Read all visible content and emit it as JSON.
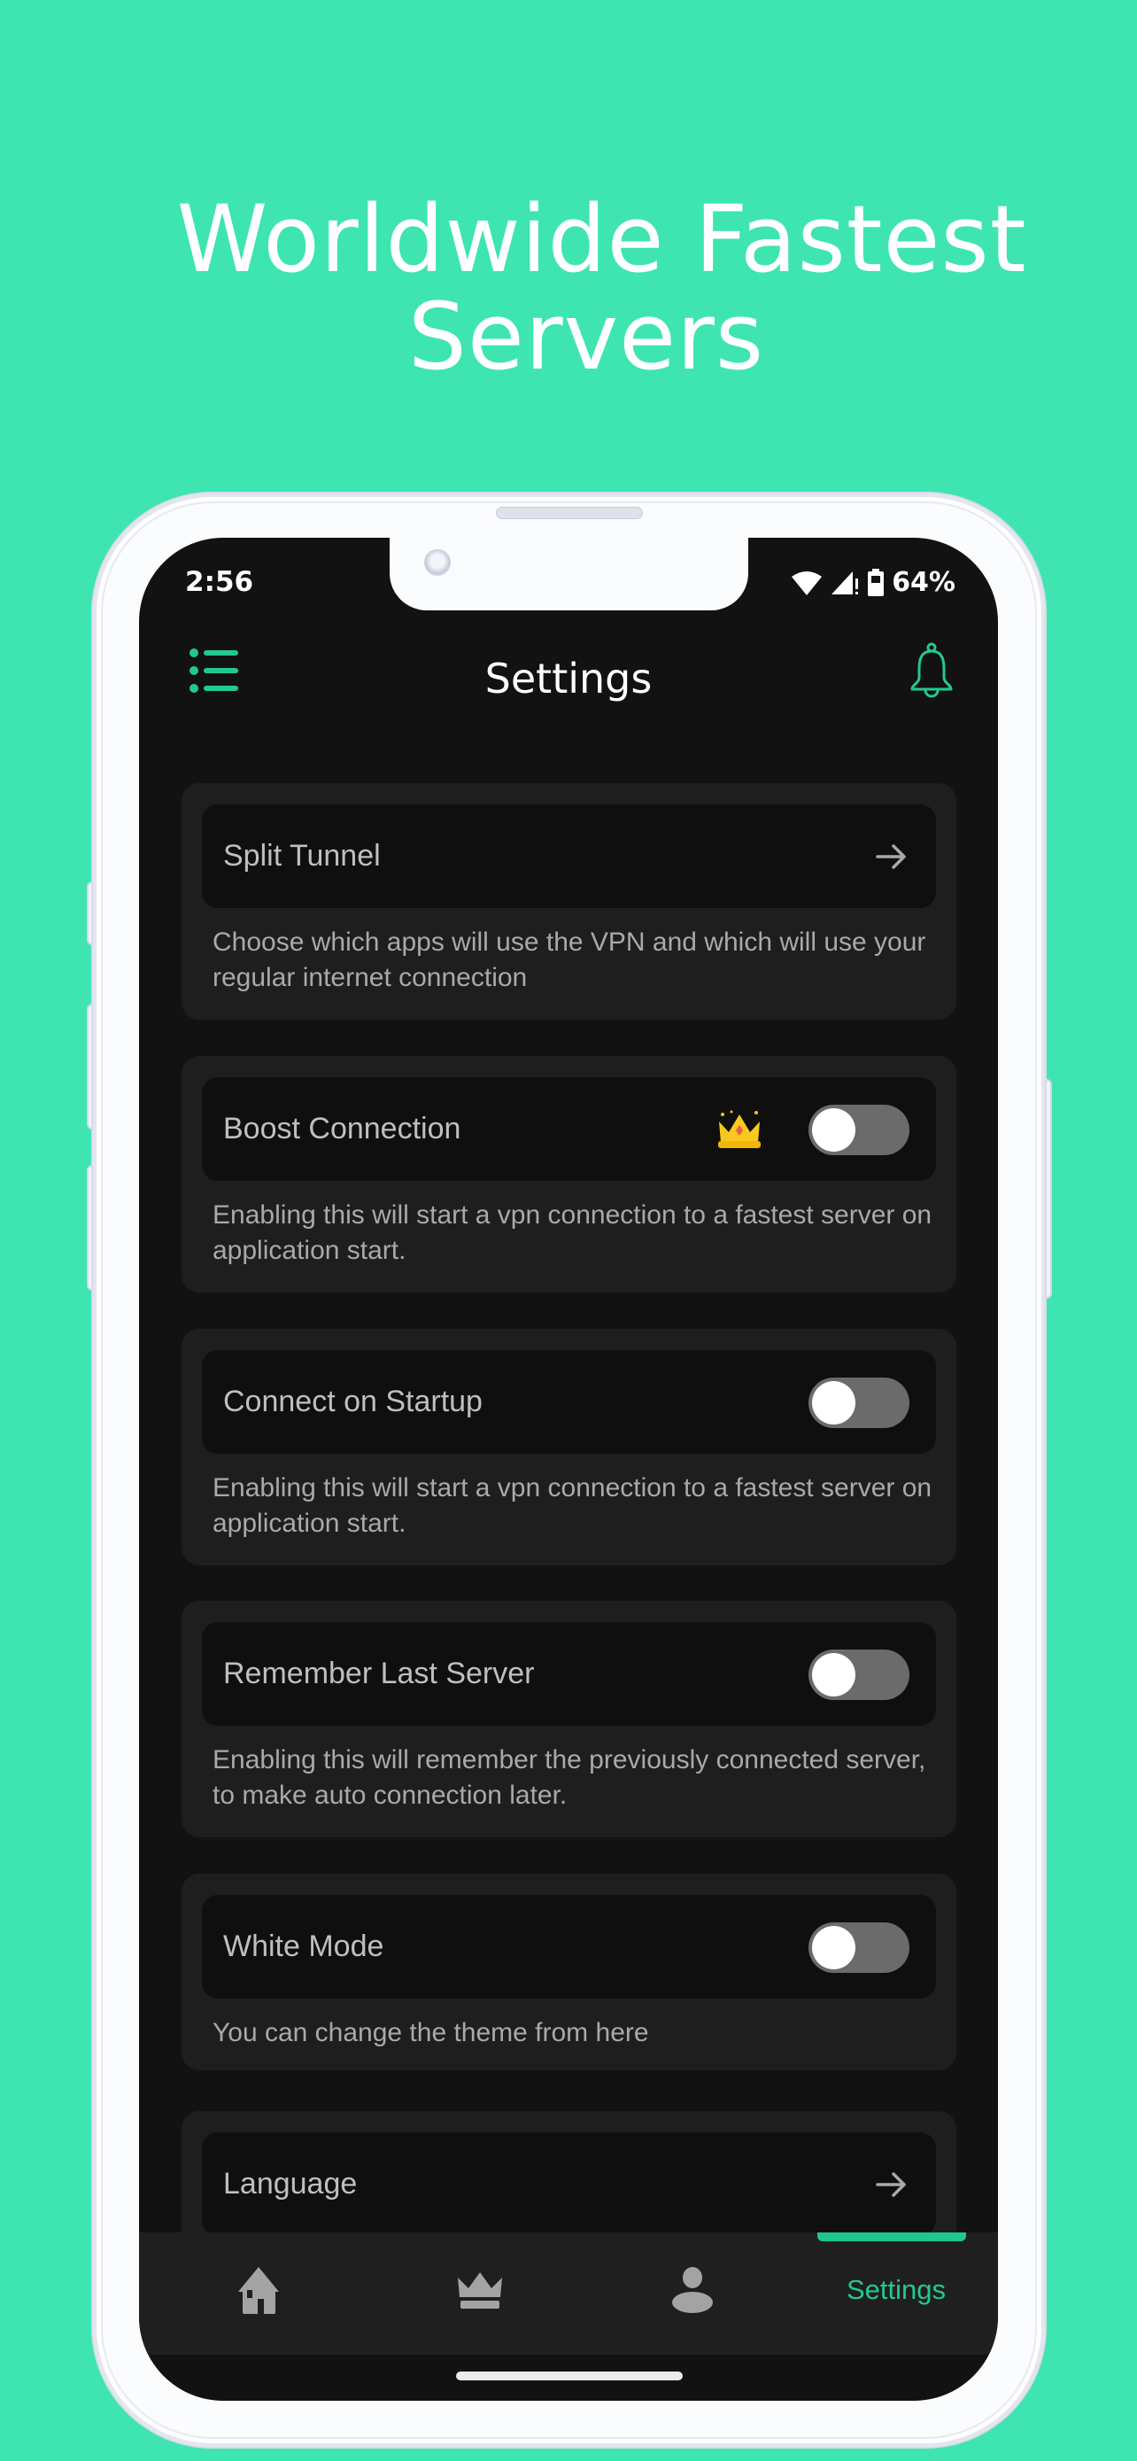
{
  "promo": {
    "headline_line1": "Worldwide Fastest",
    "headline_line2": "Servers",
    "background_color": "#3ee5b1"
  },
  "status_bar": {
    "time": "2:56",
    "battery_percent": "64%",
    "icons": [
      "wifi-icon",
      "cellular-signal-icon",
      "battery-icon"
    ]
  },
  "header": {
    "title": "Settings",
    "left_icon": "menu-list-icon",
    "right_icon": "bell-icon",
    "accent_color": "#22c98f"
  },
  "settings": [
    {
      "id": "split-tunnel",
      "label": "Split Tunnel",
      "control": "arrow",
      "description": "Choose which apps will use the VPN and which will use your regular internet connection"
    },
    {
      "id": "boost-connection",
      "label": "Boost Connection",
      "control": "toggle",
      "enabled": false,
      "premium": true,
      "description": "Enabling this will start a vpn connection to a fastest server on application start."
    },
    {
      "id": "connect-on-startup",
      "label": "Connect on Startup",
      "control": "toggle",
      "enabled": false,
      "description": "Enabling this will start a vpn connection to a fastest server on application start."
    },
    {
      "id": "remember-last-server",
      "label": "Remember Last Server",
      "control": "toggle",
      "enabled": false,
      "description": "Enabling this will remember the previously connected server, to make auto connection later."
    },
    {
      "id": "white-mode",
      "label": "White Mode",
      "control": "toggle",
      "enabled": false,
      "description": "You can change the theme from here"
    },
    {
      "id": "language",
      "label": "Language",
      "control": "arrow"
    }
  ],
  "bottom_nav": {
    "items": [
      {
        "id": "home",
        "icon": "home-icon"
      },
      {
        "id": "premium",
        "icon": "crown-icon"
      },
      {
        "id": "profile",
        "icon": "user-icon"
      },
      {
        "id": "settings",
        "label": "Settings",
        "active": true
      }
    ]
  }
}
